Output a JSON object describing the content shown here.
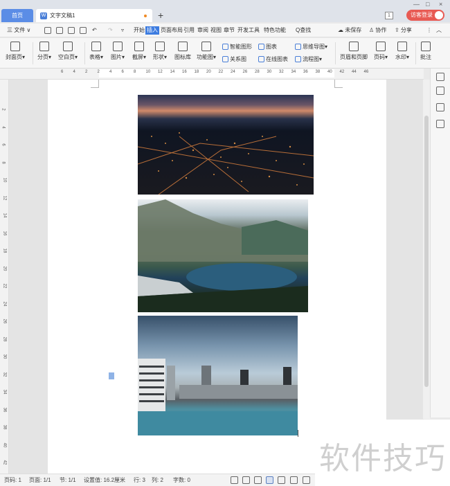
{
  "tabs": {
    "home_label": "首页",
    "doc_label": "文字文稿1",
    "doc_icon": "W",
    "add_label": "+"
  },
  "window": {
    "minimize": "—",
    "maximize": "□",
    "close": "×",
    "badge_count": "1",
    "login_label": "访客登录"
  },
  "menu": {
    "file_label": "三 文件 ∨",
    "items": [
      "开始",
      "插入",
      "页面布局",
      "引用",
      "审阅",
      "视图",
      "章节",
      "开发工具",
      "特色功能"
    ],
    "active_item": "插入",
    "search_label": "Q查找",
    "unsaved_label": "未保存",
    "collab_label": "协作",
    "share_label": "分享",
    "more_label": "⋮",
    "collapse_label": "︿"
  },
  "ribbon": {
    "cover_page": "封面页",
    "page_break": "分页",
    "blank_page": "空白页",
    "table": "表格",
    "picture": "图片",
    "screenshot": "截屏",
    "shape": "形状",
    "icon_library": "图标库",
    "function_chart": "功能图",
    "smart_shape": "智能图形",
    "chart": "图表",
    "mind_map": "思维导图",
    "relation_chart": "关系图",
    "online_chart": "在线图表",
    "flowchart": "流程图",
    "header_footer": "页眉和页脚",
    "page_number": "页码",
    "watermark": "水印",
    "comment": "批注"
  },
  "ruler": {
    "h_ticks": [
      "6",
      "4",
      "2",
      "2",
      "4",
      "6",
      "8",
      "10",
      "12",
      "14",
      "16",
      "18",
      "20",
      "22",
      "24",
      "26",
      "28",
      "30",
      "32",
      "34",
      "36",
      "38",
      "40",
      "42",
      "44",
      "46"
    ],
    "v_ticks": [
      "2",
      "4",
      "6",
      "8",
      "10",
      "12",
      "14",
      "16",
      "18",
      "20",
      "22",
      "24",
      "26",
      "28",
      "30",
      "32",
      "34",
      "36",
      "38",
      "40",
      "42"
    ]
  },
  "document": {
    "images": [
      {
        "name": "night-city-aerial-photo"
      },
      {
        "name": "mountain-lake-photo"
      },
      {
        "name": "rooftop-pool-city-photo"
      }
    ]
  },
  "statusbar": {
    "page": "页码: 1",
    "pages": "页面: 1/1",
    "section": "节: 1/1",
    "setting_value": "设置值: 16.2厘米",
    "row": "行: 3",
    "column": "列: 2",
    "word_count": "字数: 0"
  },
  "watermark_text": "软件技巧"
}
